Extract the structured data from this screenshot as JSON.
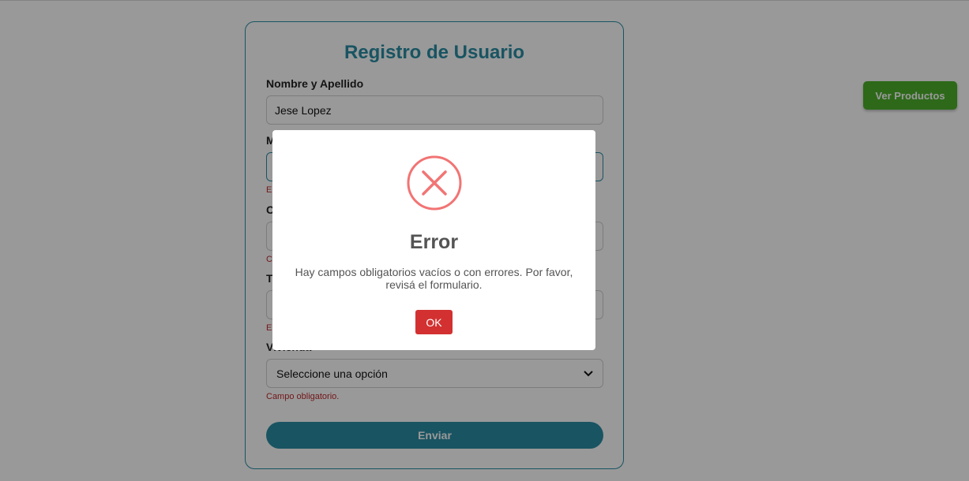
{
  "form": {
    "title": "Registro de Usuario",
    "fields": [
      {
        "label": "Nombre y Apellido",
        "value": "Jese Lopez",
        "error": ""
      },
      {
        "label": "M",
        "value": "",
        "error": "El"
      },
      {
        "label": "C",
        "value": "",
        "error": "C"
      },
      {
        "label": "Te",
        "value": "",
        "error": "El"
      }
    ],
    "vivienda": {
      "label": "Vivienda",
      "selected": "Seleccione una opción",
      "error": "Campo obligatorio."
    },
    "submit_label": "Enviar"
  },
  "side_button": {
    "label": "Ver Productos",
    "color": "#4caf2a"
  },
  "modal": {
    "icon": "error-x-icon",
    "title": "Error",
    "message": "Hay campos obligatorios vacíos o con errores. Por favor, revisá el formulario.",
    "ok_label": "OK",
    "accent": "#f27474",
    "ok_color": "#d33131"
  },
  "colors": {
    "brand": "#2a8ca3",
    "error": "#c0282d"
  }
}
